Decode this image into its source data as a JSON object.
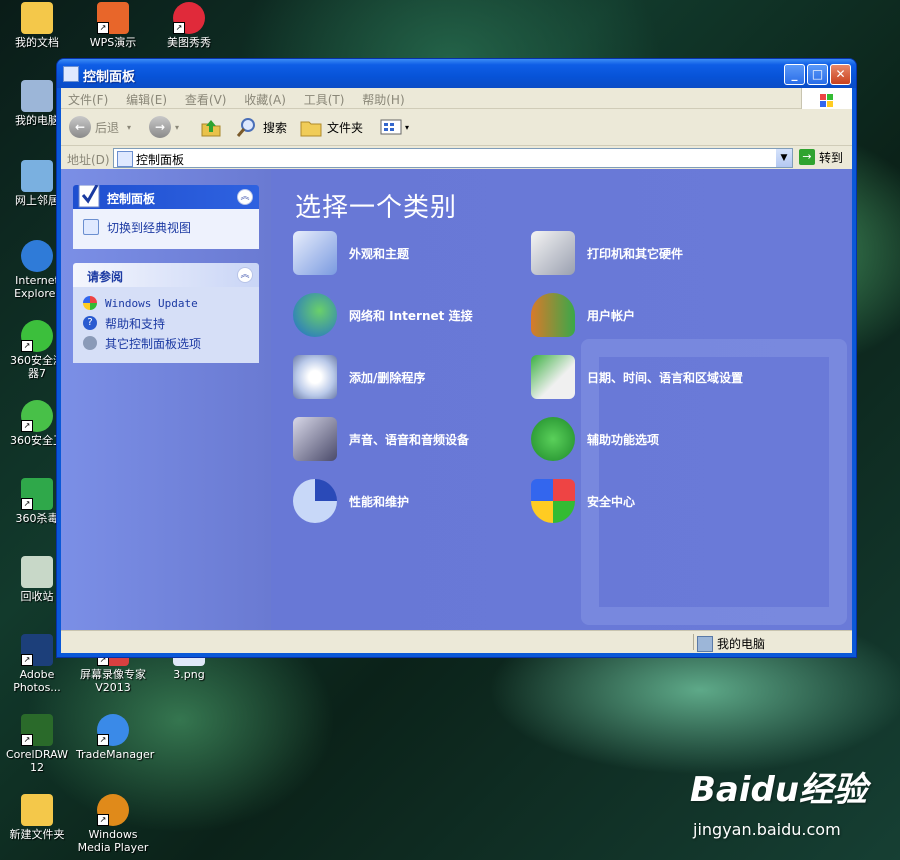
{
  "desktop": {
    "icons": [
      {
        "label": "我的文档",
        "color": "#f4c84a"
      },
      {
        "label": "WPS演示",
        "color": "#e8662a"
      },
      {
        "label": "美图秀秀",
        "color": "#e02a3a"
      },
      {
        "label": "我的电脑",
        "color": "#9cb6d8"
      },
      {
        "label": "网上邻居",
        "color": "#7ab0e0"
      },
      {
        "label": "Internet\nExplorer",
        "color": "#2f7bd8"
      },
      {
        "label": "360安全浏\n器7",
        "color": "#3cbf3c"
      },
      {
        "label": "360安全卫",
        "color": "#48c048"
      },
      {
        "label": "360杀毒",
        "color": "#2fa84a"
      },
      {
        "label": "回收站",
        "color": "#c8d8c8"
      },
      {
        "label": "Adobe\nPhotos...",
        "color": "#1c3f7a"
      },
      {
        "label": "屏幕录像专家\nV2013",
        "color": "#d84040"
      },
      {
        "label": "3.png",
        "color": "#e0e8f8"
      },
      {
        "label": "CorelDRAW 12",
        "color": "#2a6a2a"
      },
      {
        "label": "TradeManager",
        "color": "#3a8ae8"
      },
      {
        "label": "新建文件夹",
        "color": "#f4c84a"
      },
      {
        "label": "Windows\nMedia Player",
        "color": "#e08a1a"
      }
    ]
  },
  "window": {
    "title": "控制面板",
    "menu": [
      "文件(F)",
      "编辑(E)",
      "查看(V)",
      "收藏(A)",
      "工具(T)",
      "帮助(H)"
    ],
    "toolbar": {
      "back": "后退",
      "search": "搜索",
      "folders": "文件夹"
    },
    "address": {
      "label": "地址(D)",
      "value": "控制面板",
      "go": "转到"
    },
    "left": {
      "cp_title": "控制面板",
      "switch_view": "切换到经典视图",
      "see_also_title": "请参阅",
      "see_also": [
        "Windows Update",
        "帮助和支持",
        "其它控制面板选项"
      ]
    },
    "main": {
      "heading": "选择一个类别",
      "categories": [
        "外观和主题",
        "打印机和其它硬件",
        "网络和 Internet 连接",
        "用户帐户",
        "添加/删除程序",
        "日期、时间、语言和区域设置",
        "声音、语音和音频设备",
        "辅助功能选项",
        "性能和维护",
        "安全中心"
      ]
    },
    "status": {
      "location": "我的电脑"
    }
  },
  "watermark": {
    "brand": "Baidu经验",
    "url": "jingyan.baidu.com"
  }
}
